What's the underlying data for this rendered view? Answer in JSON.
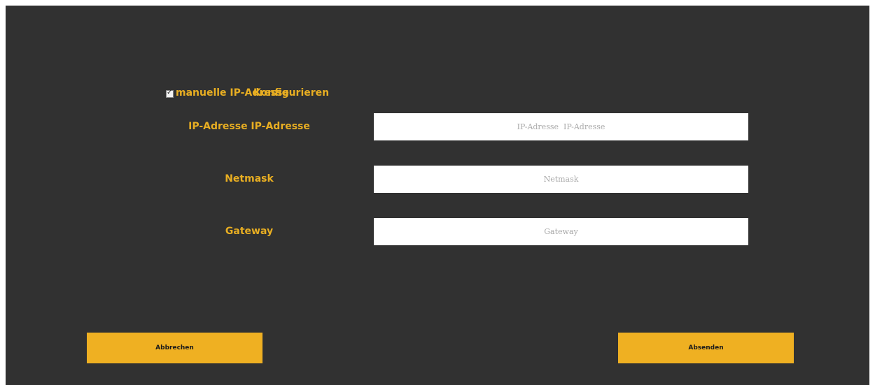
{
  "manual_config": {
    "checked": true,
    "label_part_1": "manuelle IP-Adresse",
    "label_part_2": "Konfigurieren"
  },
  "fields": {
    "ip": {
      "label": "IP-Adresse  IP-Adresse",
      "placeholder": "IP-Adresse  IP-Adresse",
      "value": ""
    },
    "netmask": {
      "label": "Netmask",
      "placeholder": "Netmask",
      "value": ""
    },
    "gateway": {
      "label": "Gateway",
      "placeholder": "Gateway",
      "value": ""
    }
  },
  "buttons": {
    "cancel": "Abbrechen",
    "submit": "Absenden"
  },
  "colors": {
    "background": "#313131",
    "accent": "#efb022",
    "label_text": "#e8ae22"
  }
}
